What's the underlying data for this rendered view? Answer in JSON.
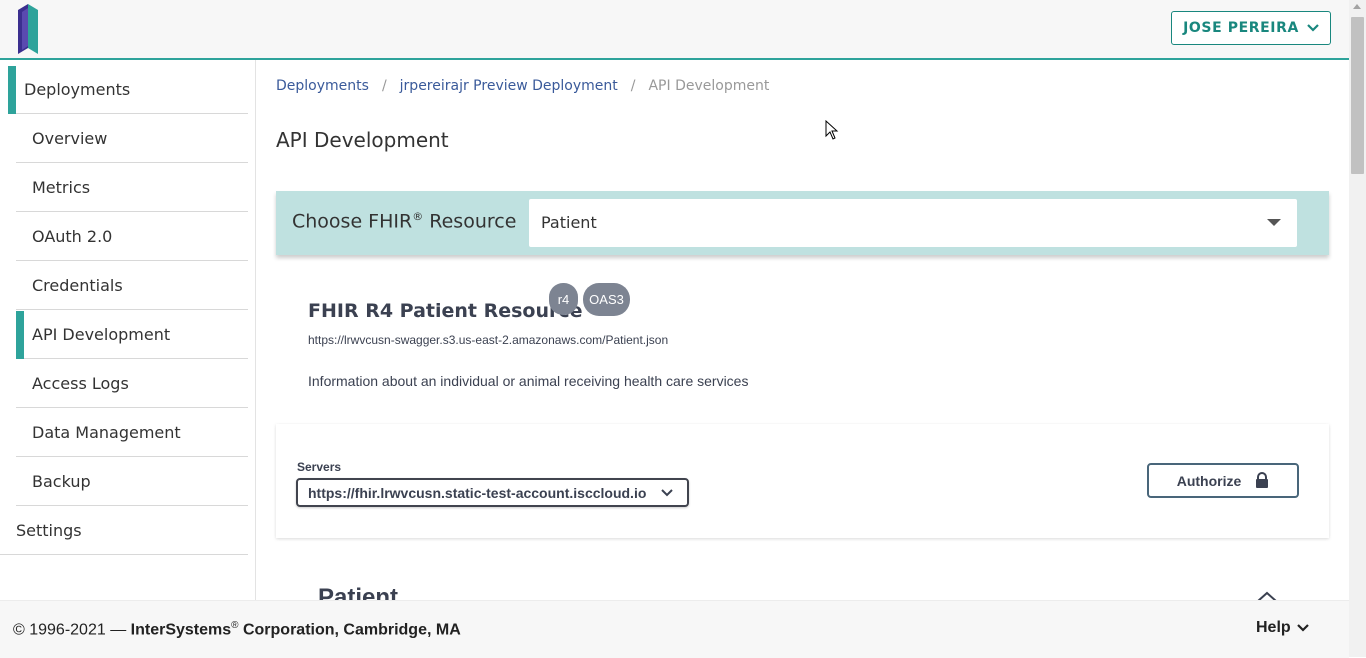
{
  "header": {
    "logo_icon": "intersystems-logo",
    "user_label": "JOSE PEREIRA",
    "accent_color": "#19877e"
  },
  "sidebar": {
    "section": "Deployments",
    "items": [
      {
        "label": "Overview"
      },
      {
        "label": "Metrics"
      },
      {
        "label": "OAuth 2.0"
      },
      {
        "label": "Credentials"
      },
      {
        "label": "API Development",
        "active": true
      },
      {
        "label": "Access Logs"
      },
      {
        "label": "Data Management"
      },
      {
        "label": "Backup"
      }
    ],
    "settings": "Settings"
  },
  "breadcrumb": {
    "items": [
      "Deployments",
      "jrpereirajr Preview Deployment",
      "API Development"
    ],
    "separator": "/"
  },
  "page": {
    "title": "API Development",
    "choose_label": "Choose FHIR",
    "choose_label_sup": "®",
    "choose_label_tail": " Resource",
    "selected_resource": "Patient"
  },
  "resource": {
    "title": "FHIR R4 Patient Resource",
    "version_badge": "r4",
    "spec_badge": "OAS3",
    "url": "https://lrwvcusn-swagger.s3.us-east-2.amazonaws.com/Patient.json",
    "description": "Information about an individual or animal receiving health care services"
  },
  "servers": {
    "label": "Servers",
    "selected": "https://fhir.lrwvcusn.static-test-account.isccloud.io",
    "authorize_label": "Authorize"
  },
  "tag": {
    "title": "Patient"
  },
  "footer": {
    "copyright_prefix": "© 1996-2021 — ",
    "company": "InterSystems",
    "company_sup": "®",
    "copyright_suffix": " Corporation, Cambridge, MA",
    "help_label": "Help"
  }
}
